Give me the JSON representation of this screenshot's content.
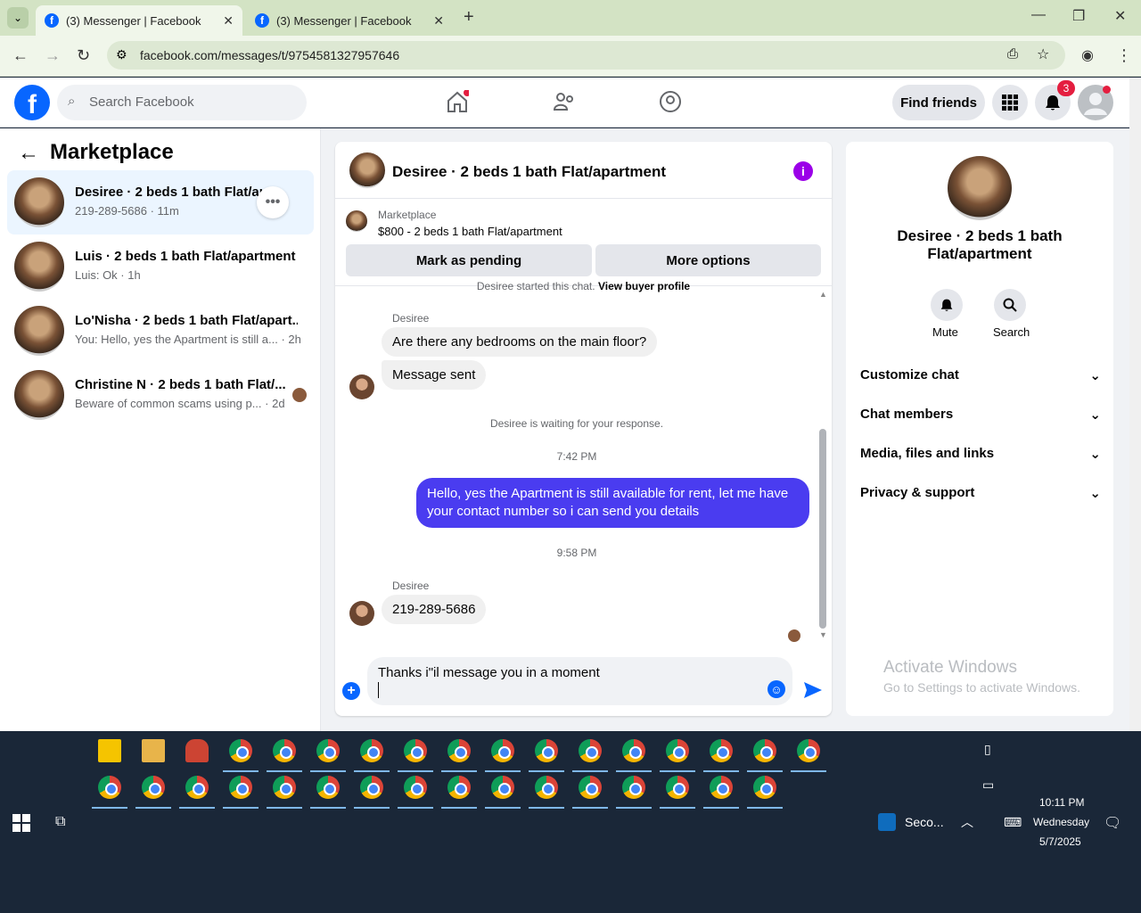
{
  "browser": {
    "tabs": [
      {
        "label": "(3) Messenger | Facebook",
        "active": true
      },
      {
        "label": "(3) Messenger | Facebook",
        "active": false
      }
    ],
    "url": "facebook.com/messages/t/9754581327957646"
  },
  "fb": {
    "logo": "f",
    "search_placeholder": "Search Facebook",
    "find_friends": "Find friends",
    "notif_count": "3"
  },
  "left": {
    "title": "Marketplace",
    "conversations": [
      {
        "title": "Desiree · 2 beds 1 bath Flat/apa",
        "sub": "219-289-5686 · 11m"
      },
      {
        "title": "Luis · 2 beds 1 bath Flat/apartment",
        "sub": "Luis: Ok · 1h"
      },
      {
        "title": "Lo'Nisha · 2 beds 1 bath Flat/apart...",
        "sub": "You: Hello, yes the Apartment is still a... · 2h"
      },
      {
        "title": "Christine N · 2 beds 1 bath Flat/...",
        "sub": "Beware of common scams using p... · 2d"
      }
    ]
  },
  "chat": {
    "header_title": "Desiree · 2 beds 1 bath Flat/apartment",
    "listing_source": "Marketplace",
    "listing_desc": "$800 - 2 beds 1 bath Flat/apartment",
    "mark_pending": "Mark as pending",
    "more_options": "More options",
    "started_text": "Desiree started this chat.",
    "view_profile": "View buyer profile",
    "sender1": "Desiree",
    "msg1": "Are there any bedrooms on the main floor?",
    "msg2": "Message sent",
    "waiting": "Desiree is waiting for your response.",
    "time1": "7:42 PM",
    "msg3": "Hello, yes the Apartment is still available for rent, let me have your contact number so i can send you details",
    "time2": "9:58 PM",
    "sender2": "Desiree",
    "msg4": "219-289-5686",
    "composer_text": "Thanks i\"il message you in a moment"
  },
  "right": {
    "title": "Desiree · 2 beds 1 bath Flat/apartment",
    "mute": "Mute",
    "search": "Search",
    "rows": [
      "Customize chat",
      "Chat members",
      "Media, files and links",
      "Privacy & support"
    ],
    "activate_title": "Activate Windows",
    "activate_sub": "Go to Settings to activate Windows."
  },
  "taskbar": {
    "outlook_label": "Seco...",
    "time": "10:11 PM",
    "day": "Wednesday",
    "date": "5/7/2025"
  },
  "colors": {
    "accent": "#0866ff",
    "my_bubble": "#4a3cf0",
    "info": "#9b00e8"
  }
}
